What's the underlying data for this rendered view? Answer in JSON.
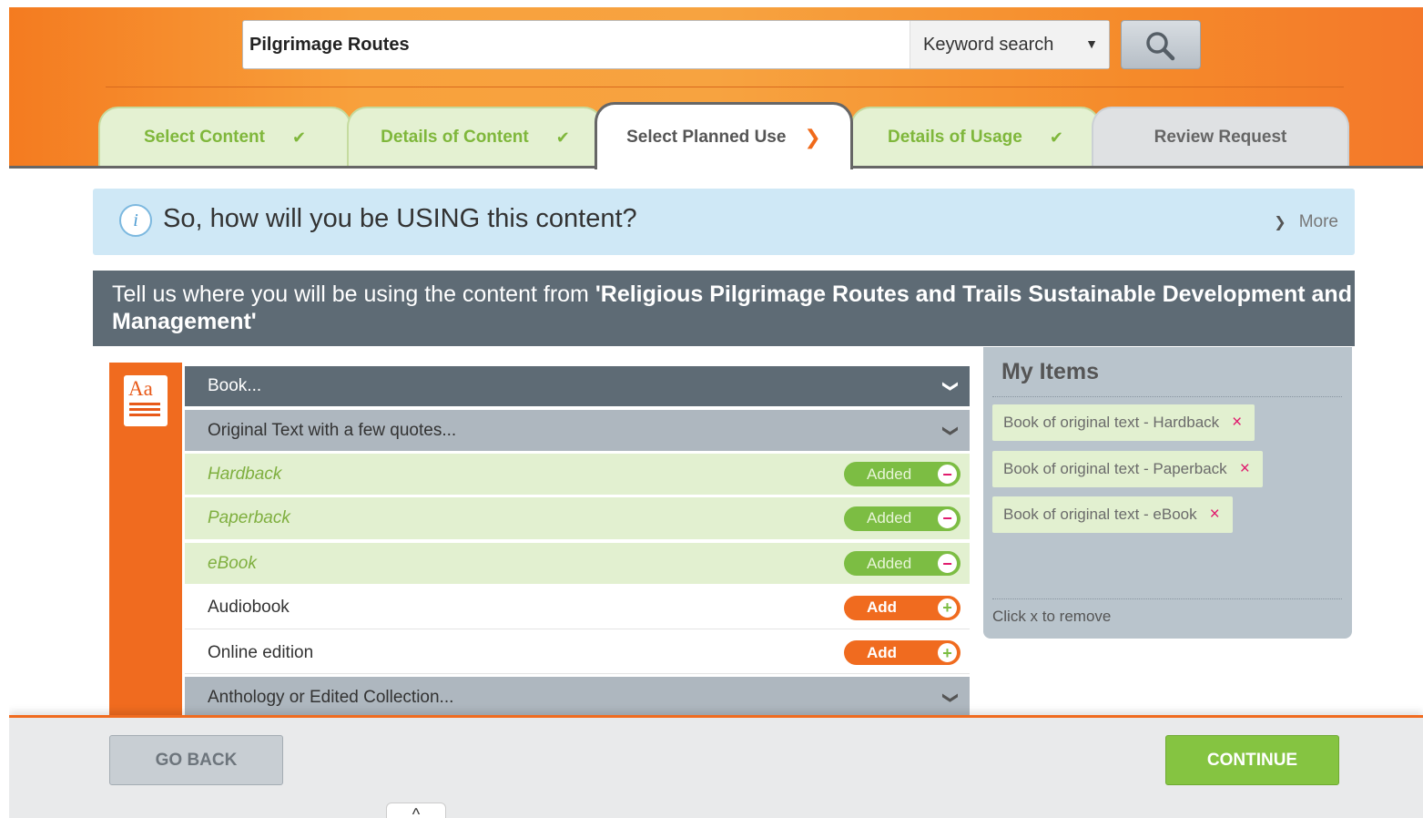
{
  "search": {
    "query": "Pilgrimage Routes",
    "mode": "Keyword search"
  },
  "tabs": [
    {
      "label": "Select Content",
      "state": "done",
      "mark": "✔"
    },
    {
      "label": "Details of Content",
      "state": "done",
      "mark": "✔"
    },
    {
      "label": "Select Planned Use",
      "state": "current",
      "mark": "❯"
    },
    {
      "label": "Details of Usage",
      "state": "done",
      "mark": "✔"
    },
    {
      "label": "Review Request",
      "state": "pending",
      "mark": ""
    }
  ],
  "info": {
    "icon": "i",
    "question": "So, how will you be USING this content?",
    "more_label": "More"
  },
  "section": {
    "prefix": "Tell us where you will be using the content from ",
    "title": "'Religious Pilgrimage Routes and Trails Sustainable Development and Management'"
  },
  "book_icon": {
    "text": "Aa"
  },
  "usage": {
    "category": "Book...",
    "subcategory": "Original Text with a few quotes...",
    "options": [
      {
        "label": "Hardback",
        "status": "Added"
      },
      {
        "label": "Paperback",
        "status": "Added"
      },
      {
        "label": "eBook",
        "status": "Added"
      },
      {
        "label": "Audiobook",
        "status": "Add"
      },
      {
        "label": "Online edition",
        "status": "Add"
      }
    ],
    "next_category": "Anthology or Edited Collection..."
  },
  "my_items": {
    "title": "My Items",
    "items": [
      {
        "label": "Book of original text - Hardback"
      },
      {
        "label": "Book of original text - Paperback"
      },
      {
        "label": "Book of original text - eBook"
      }
    ],
    "remove_glyph": "×",
    "hint": "Click x to remove"
  },
  "footer": {
    "back_label": "GO BACK",
    "continue_label": "CONTINUE"
  },
  "colors": {
    "accent_orange": "#f06b1f",
    "success_green": "#7cbd43",
    "remove_pink": "#e0186c",
    "slate": "#5e6b75"
  }
}
